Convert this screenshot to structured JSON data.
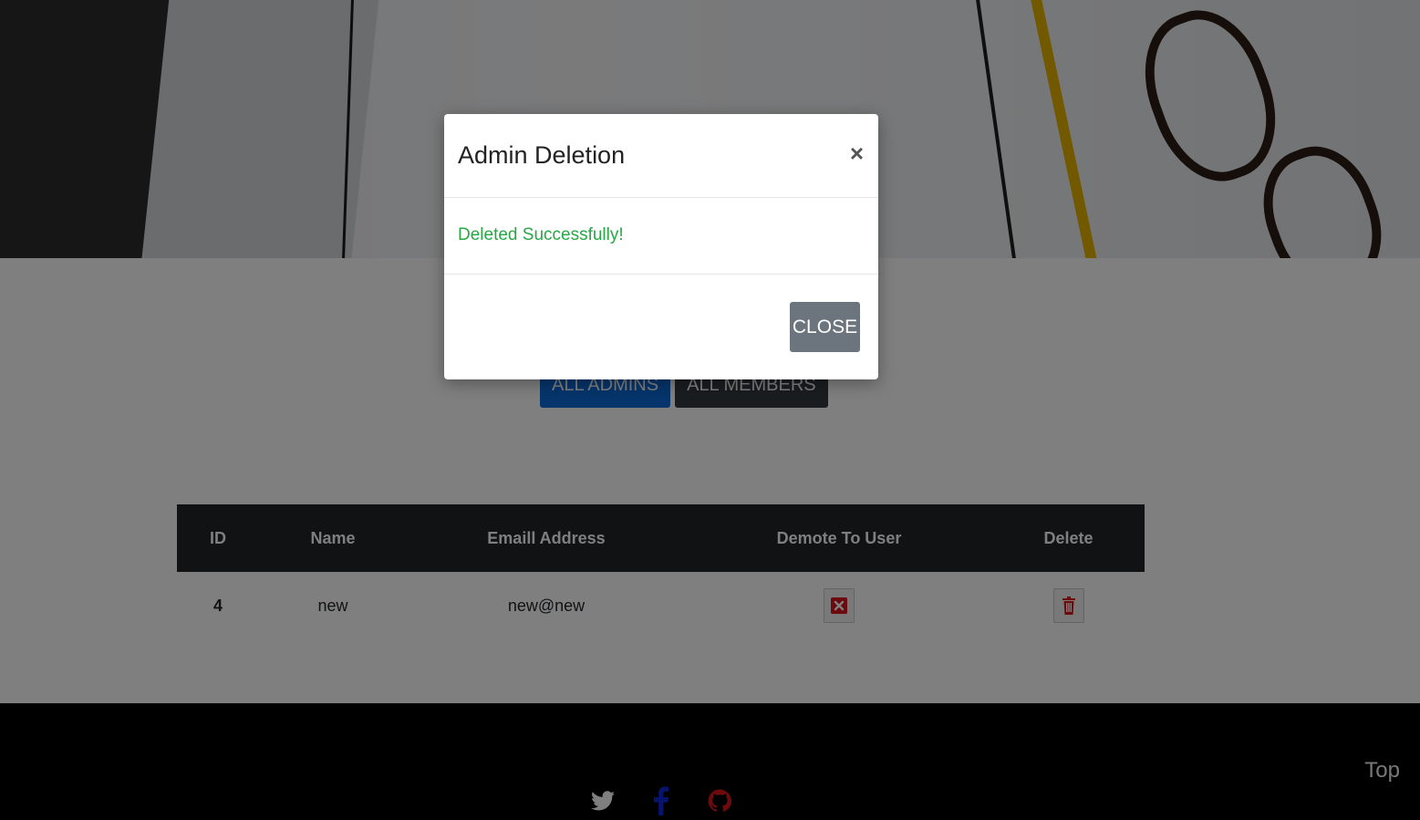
{
  "tabs": {
    "all_admins": "ALL ADMINS",
    "all_members": "ALL MEMBERS"
  },
  "table": {
    "headers": [
      "ID",
      "Name",
      "Emaill Address",
      "Demote To User",
      "Delete"
    ],
    "rows": [
      {
        "id": "4",
        "name": "new",
        "email": "new@new",
        "demote_icon": "close-square-icon",
        "delete_icon": "trash-icon"
      }
    ]
  },
  "footer": {
    "social_icons": [
      "twitter-icon",
      "facebook-icon",
      "github-icon"
    ],
    "top_link": "Top"
  },
  "modal": {
    "title": "Admin Deletion",
    "close_symbol": "×",
    "message": "Deleted Successfully!",
    "close_button": "CLOSE"
  },
  "colors": {
    "success": "#28a745",
    "primary": "#0a6bd8",
    "dark": "#343a40",
    "danger": "#d9141c",
    "secondary": "#6c757d"
  }
}
